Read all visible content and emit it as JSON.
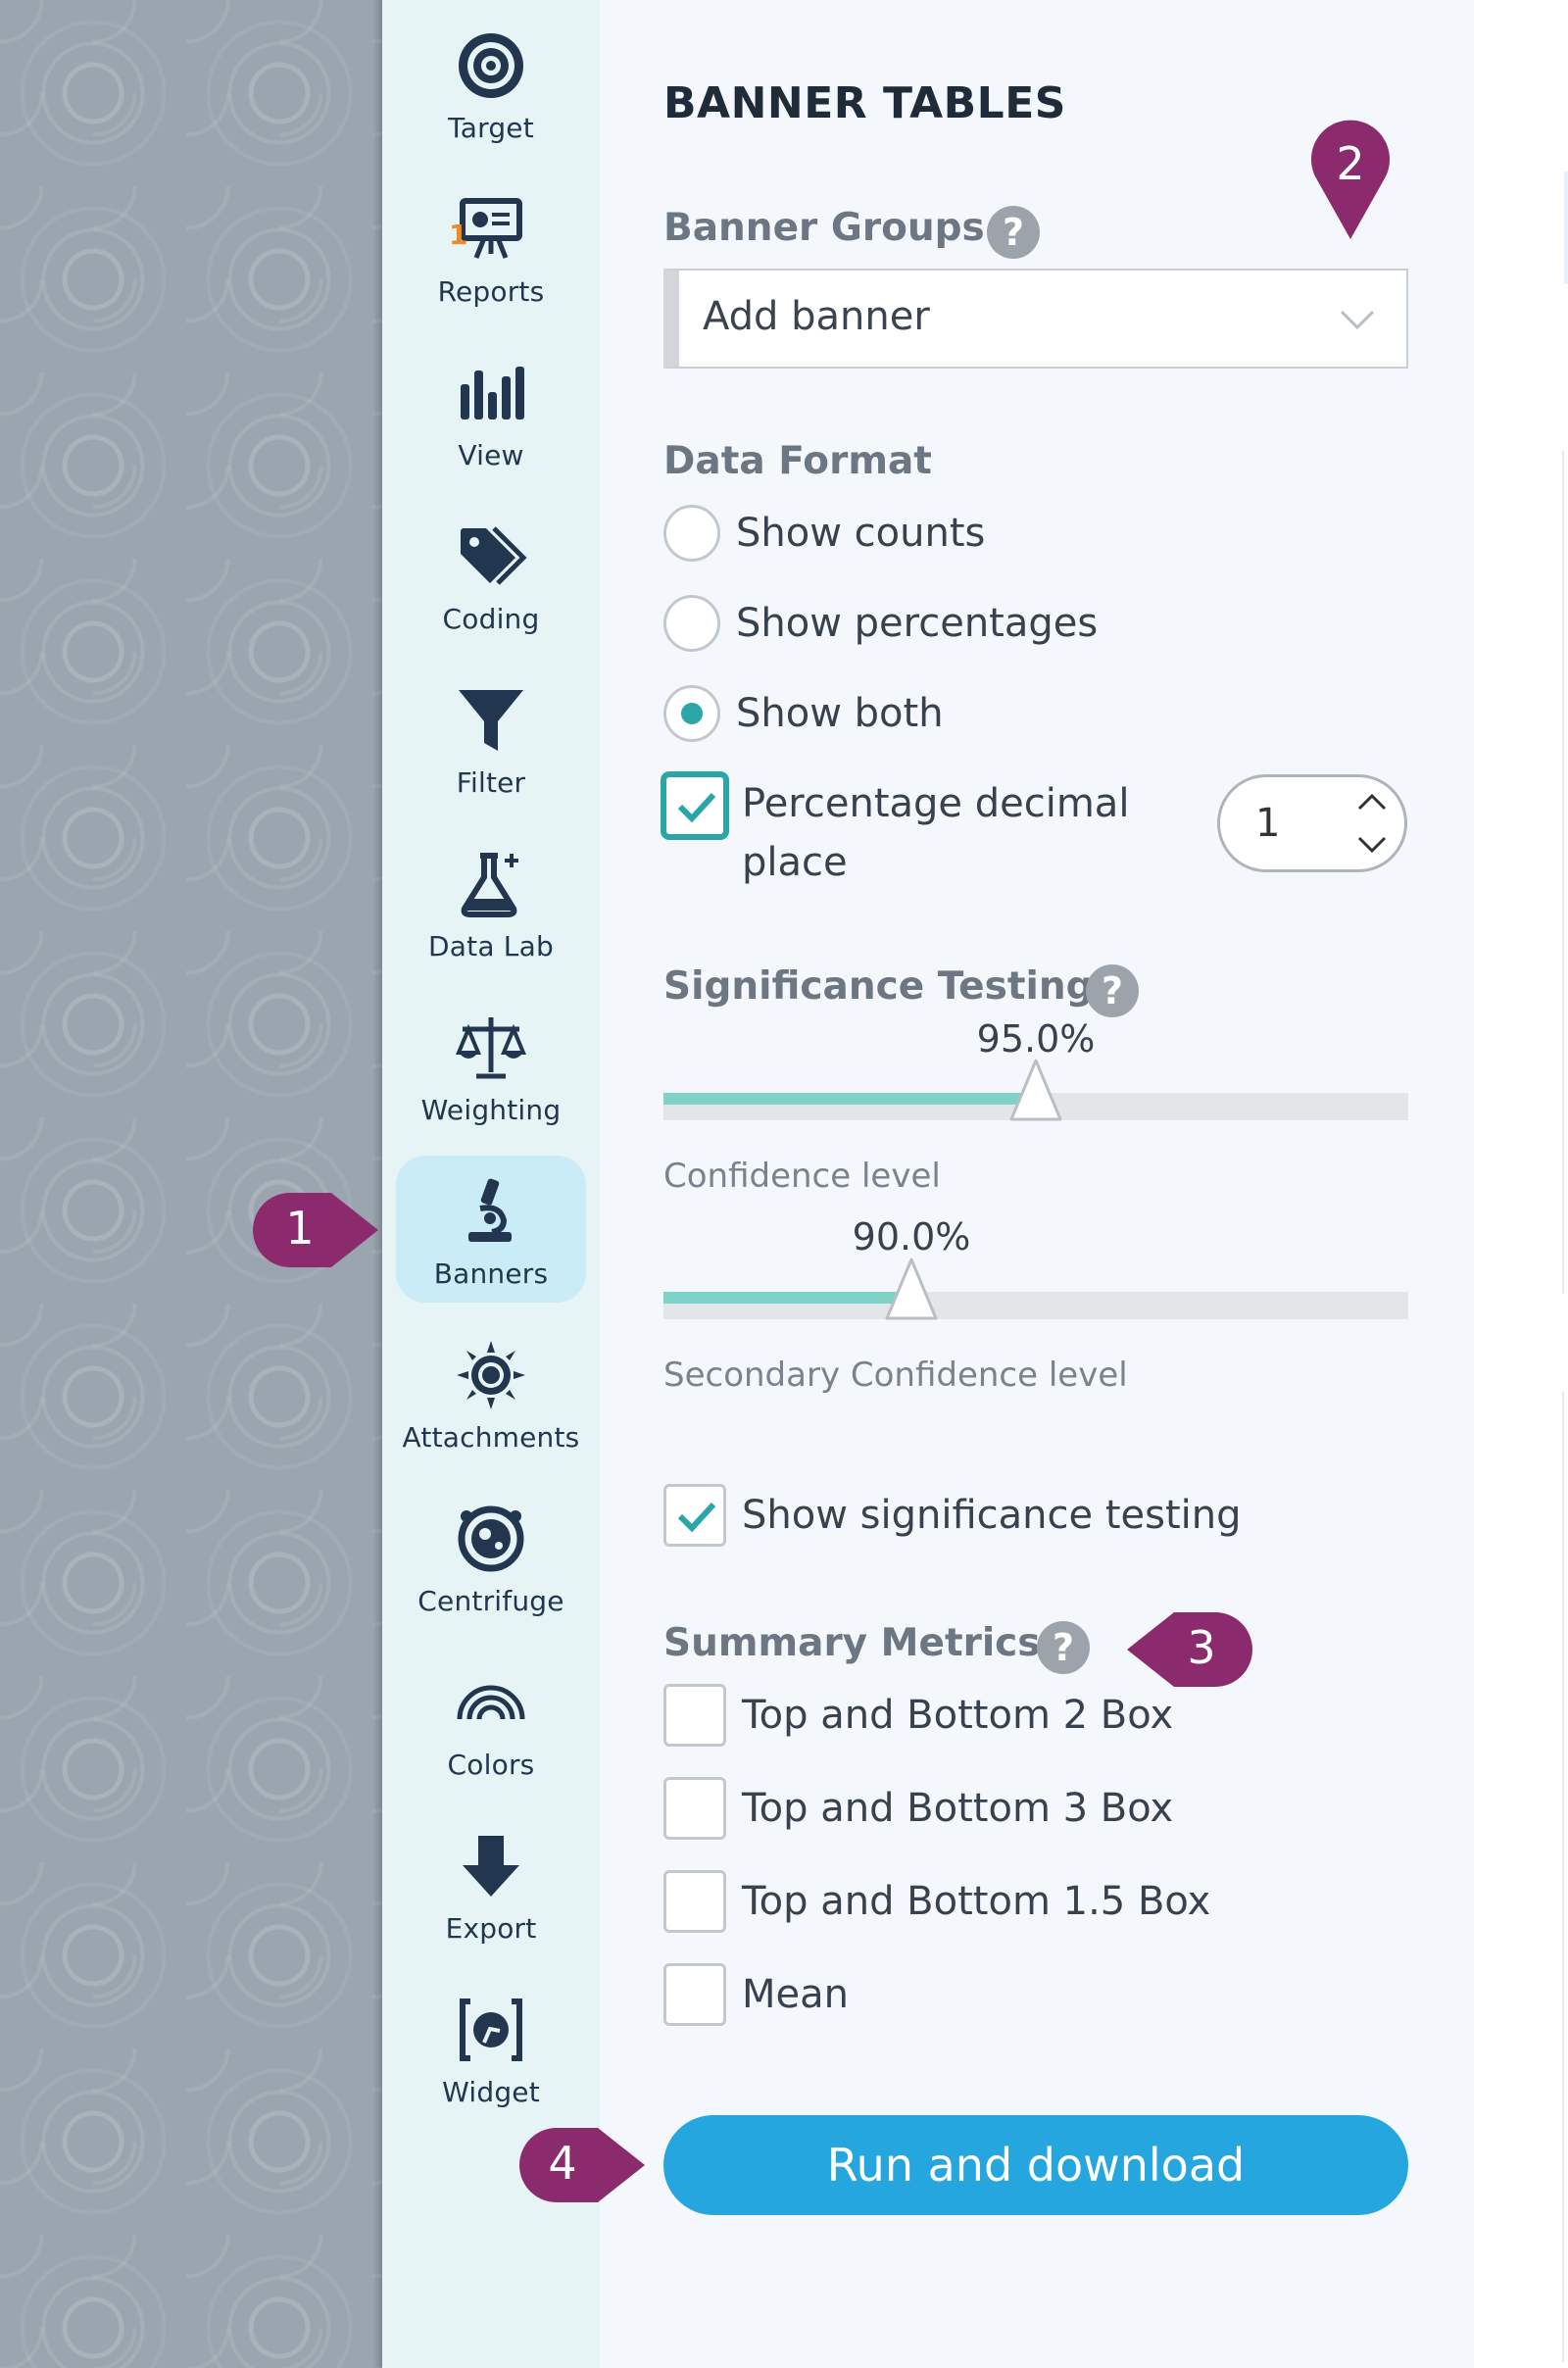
{
  "nav": {
    "items": [
      {
        "label": "Target",
        "icon": "target-icon"
      },
      {
        "label": "Reports",
        "icon": "presentation-board-icon",
        "badge": "1"
      },
      {
        "label": "View",
        "icon": "bar-chart-icon"
      },
      {
        "label": "Coding",
        "icon": "tag-icon"
      },
      {
        "label": "Filter",
        "icon": "funnel-icon"
      },
      {
        "label": "Data Lab",
        "icon": "flask-icon"
      },
      {
        "label": "Weighting",
        "icon": "balance-scale-icon"
      },
      {
        "label": "Banners",
        "icon": "microscope-icon",
        "active": true
      },
      {
        "label": "Attachments",
        "icon": "sun-icon"
      },
      {
        "label": "Centrifuge",
        "icon": "centrifuge-icon"
      },
      {
        "label": "Colors",
        "icon": "rainbow-icon"
      },
      {
        "label": "Export",
        "icon": "down-arrow-icon"
      },
      {
        "label": "Widget",
        "icon": "widget-icon"
      }
    ]
  },
  "panel": {
    "title": "BANNER TABLES",
    "banner_groups": {
      "label": "Banner Groups",
      "help": "?",
      "select_value": "Add banner"
    },
    "data_format": {
      "label": "Data Format",
      "options": [
        {
          "label": "Show counts",
          "checked": false
        },
        {
          "label": "Show percentages",
          "checked": false
        },
        {
          "label": "Show both",
          "checked": true
        }
      ],
      "decimal_label": "Percentage decimal place",
      "decimal_checked": true,
      "decimal_value": "1"
    },
    "significance": {
      "label": "Significance Testing",
      "help": "?",
      "confidence": {
        "value": "95.0%",
        "fraction": 0.5,
        "caption": "Confidence level"
      },
      "secondary": {
        "value": "90.0%",
        "fraction": 0.333,
        "caption": "Secondary Confidence level"
      },
      "show_label": "Show significance testing",
      "show_checked": true
    },
    "summary_metrics": {
      "label": "Summary Metrics",
      "help": "?",
      "options": [
        {
          "label": "Top and Bottom 2 Box",
          "checked": false
        },
        {
          "label": "Top and Bottom 3 Box",
          "checked": false
        },
        {
          "label": "Top and Bottom 1.5 Box",
          "checked": false
        },
        {
          "label": "Mean",
          "checked": false
        }
      ]
    },
    "run_button": "Run and download"
  },
  "callouts": [
    "1",
    "2",
    "3",
    "4"
  ],
  "colors": {
    "accent": "#2aa6a8",
    "button": "#26a6df",
    "callout": "#8c2a6e",
    "badge": "#f08a24",
    "icon": "#22374f"
  }
}
